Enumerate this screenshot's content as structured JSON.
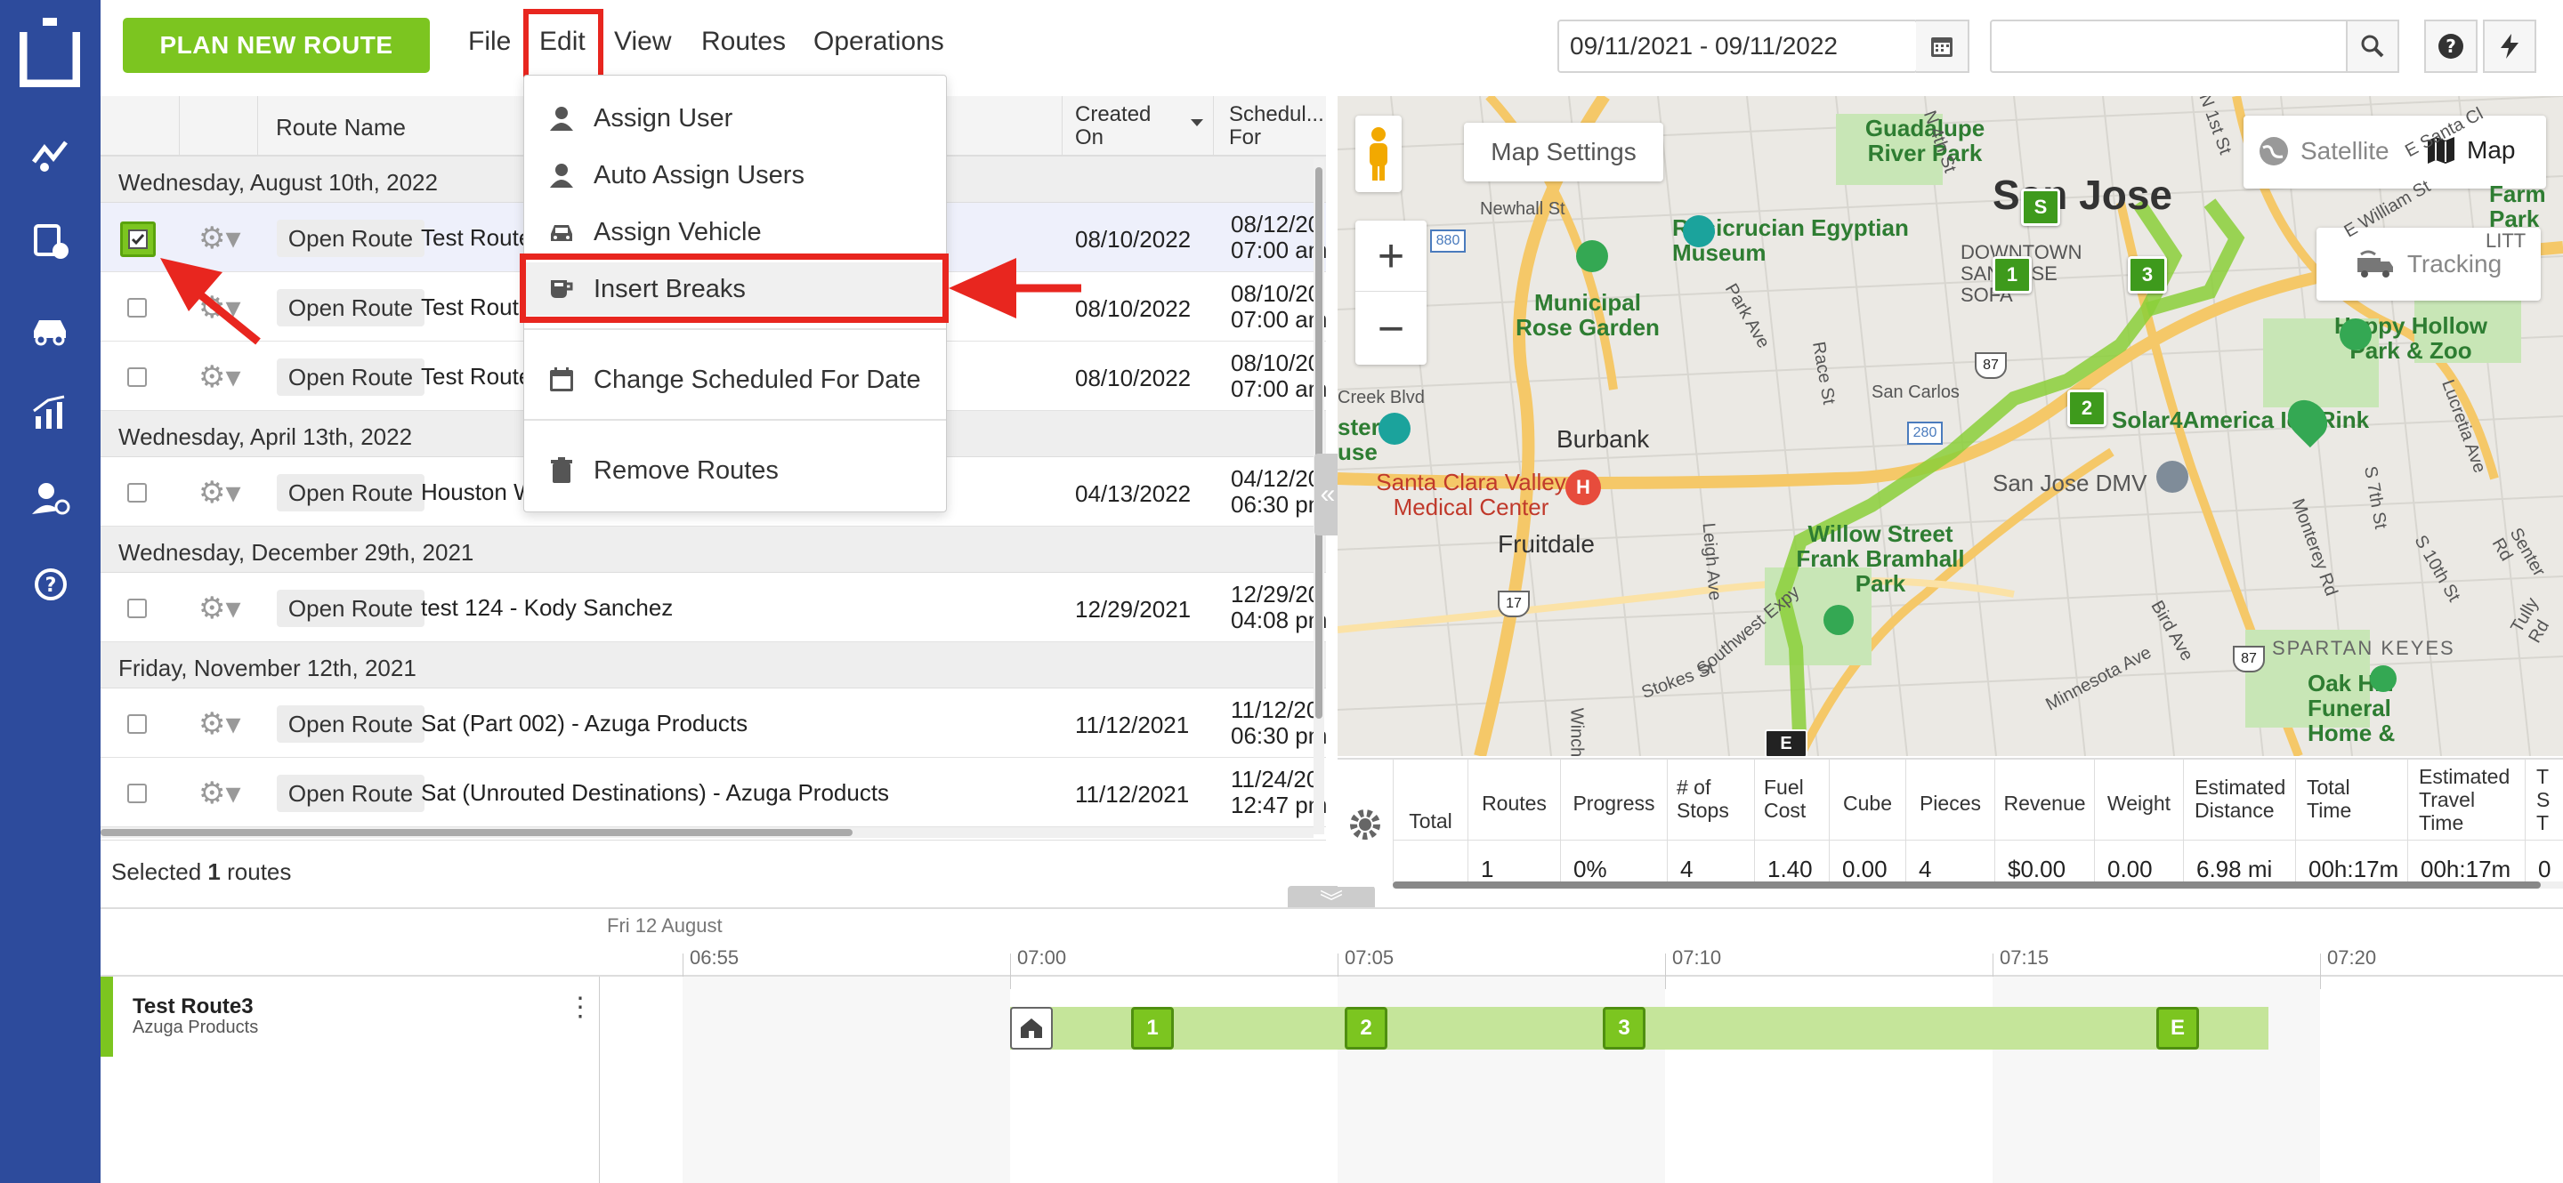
{
  "toolbar": {
    "plan_button": "PLAN NEW ROUTE",
    "menus": [
      "File",
      "Edit",
      "View",
      "Routes",
      "Operations"
    ],
    "date_range": "09/11/2021 - 09/11/2022",
    "search_value": ""
  },
  "edit_menu": {
    "items": [
      "Assign User",
      "Auto Assign Users",
      "Assign Vehicle",
      "Insert Breaks",
      "Change Scheduled For Date",
      "Remove Routes"
    ],
    "highlighted": "Insert Breaks"
  },
  "grid": {
    "headers": {
      "route_name": "Route Name",
      "created_on": "Created On",
      "scheduled_for": "Schedul... For"
    },
    "open_button": "Open Route",
    "groups": [
      {
        "label": "Wednesday, August 10th, 2022",
        "rows": [
          {
            "name": "Test Route",
            "created": "08/10/2022",
            "sched": [
              "08/12/20",
              "07:00 am"
            ],
            "checked": true
          },
          {
            "name": "Test Route",
            "created": "08/10/2022",
            "sched": [
              "08/10/20",
              "07:00 am"
            ],
            "checked": false
          },
          {
            "name": "Test Route",
            "created": "08/10/2022",
            "sched": [
              "08/10/20",
              "07:00 am"
            ],
            "checked": false
          }
        ]
      },
      {
        "label": "Wednesday, April 13th, 2022",
        "rows": [
          {
            "name": "Houston W",
            "created": "04/13/2022",
            "sched": [
              "04/12/20",
              "06:30 pm"
            ],
            "checked": false
          }
        ]
      },
      {
        "label": "Wednesday, December 29th, 2021",
        "rows": [
          {
            "name": "test 124 - Kody Sanchez",
            "created": "12/29/2021",
            "sched": [
              "12/29/20",
              "04:08 pm"
            ],
            "checked": false
          }
        ]
      },
      {
        "label": "Friday, November 12th, 2021",
        "rows": [
          {
            "name": "Sat (Part 002) - Azuga Products",
            "created": "11/12/2021",
            "sched": [
              "11/12/20",
              "06:30 pm"
            ],
            "checked": false
          },
          {
            "name": "Sat (Unrouted Destinations) - Azuga Products",
            "created": "11/12/2021",
            "sched": [
              "11/24/20",
              "12:47 pm"
            ],
            "checked": false
          }
        ]
      }
    ],
    "footer_prefix": "Selected",
    "footer_count": "1",
    "footer_suffix": "routes"
  },
  "map": {
    "settings_button": "Map Settings",
    "satellite": "Satellite",
    "map": "Map",
    "tracking": "Tracking",
    "zoom_in": "+",
    "zoom_out": "−",
    "places": {
      "san_jose": "San Jose",
      "guadalupe": "Guadalupe River Park",
      "rosicrucian": "Rosicrucian Egyptian Museum",
      "municipal": "Municipal Rose Garden",
      "happy_hollow": "Happy Hollow Park & Zoo",
      "ice_rink": "Solar4America Ice Rink",
      "sj_dmv": "San Jose DMV",
      "burbank": "Burbank",
      "fruitdale": "Fruitdale",
      "santa_clara": "Santa Clara Valley Medical Center",
      "willow": "Willow Street Frank Bramhall Park",
      "spartan": "SPARTAN KEYES",
      "oak_hill": "Oak Hill Funeral Home &",
      "downtown": "DOWNTOWN SAN JOSE SOFA",
      "farm_park": "Farm Park",
      "litt": "LITT",
      "ster_use": "ster use"
    },
    "streets": [
      "Newhall St",
      "N 4th St",
      "E Santa Cl",
      "Park Ave",
      "Race St",
      "San Carlos",
      "Creek Blvd",
      "Leigh Ave",
      "Southwest Expy",
      "Stokes St",
      "Minnesota Ave",
      "Bird Ave",
      "Monterey Rd",
      "S 10th St",
      "Senter Rd",
      "Tully Rd",
      "Lucretia Ave",
      "S 7th St",
      "Winch",
      "E William St",
      "N 1st St"
    ],
    "pins": [
      "S",
      "1",
      "2",
      "3",
      "E"
    ],
    "highways": [
      "880",
      "87",
      "280",
      "17",
      "87"
    ]
  },
  "stats": {
    "total_label": "Total",
    "columns": [
      {
        "head": "Routes",
        "val": "1"
      },
      {
        "head": "Progress",
        "val": "0%"
      },
      {
        "head": "# of Stops",
        "val": "4"
      },
      {
        "head": "Fuel Cost",
        "val": "1.40"
      },
      {
        "head": "Cube",
        "val": "0.00"
      },
      {
        "head": "Pieces",
        "val": "4"
      },
      {
        "head": "Revenue",
        "val": "$0.00"
      },
      {
        "head": "Weight",
        "val": "0.00"
      },
      {
        "head": "Estimated Distance",
        "val": "6.98 mi"
      },
      {
        "head": "Total Time",
        "val": "00h:17m"
      },
      {
        "head": "Estimated Travel Time",
        "val": "00h:17m"
      },
      {
        "head": "T S T",
        "val": "0"
      }
    ]
  },
  "timeline": {
    "date": "Fri 12 August",
    "ticks": [
      "06:55",
      "07:00",
      "07:05",
      "07:10",
      "07:15",
      "07:20"
    ],
    "route_name": "Test Route3",
    "route_company": "Azuga Products",
    "stops": [
      "1",
      "2",
      "3",
      "E"
    ]
  },
  "colors": {
    "accent": "#7cc520",
    "sidebar": "#2d4b9c",
    "highlight": "#e8261f"
  }
}
